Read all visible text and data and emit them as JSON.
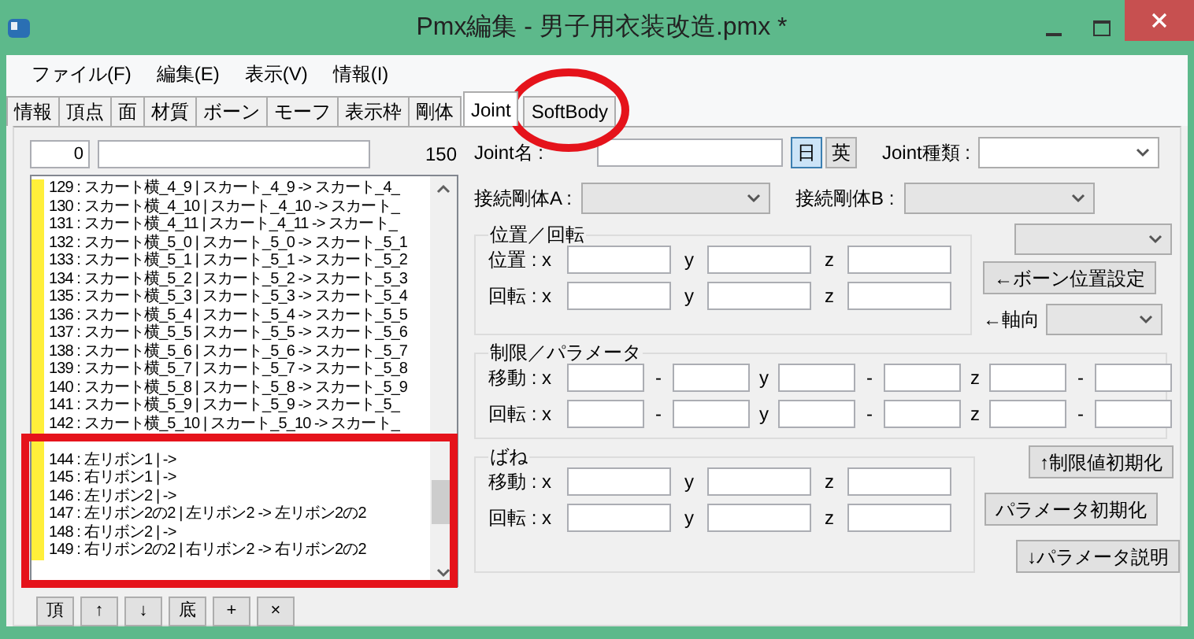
{
  "window": {
    "title": "Pmx編集 - 男子用衣装改造.pmx *"
  },
  "menu": [
    "ファイル(F)",
    "編集(E)",
    "表示(V)",
    "情報(I)"
  ],
  "tabs": [
    {
      "label": "情報",
      "selected": false
    },
    {
      "label": "頂点",
      "selected": false
    },
    {
      "label": "面",
      "selected": false
    },
    {
      "label": "材質",
      "selected": false
    },
    {
      "label": "ボーン",
      "selected": false
    },
    {
      "label": "モーフ",
      "selected": false
    },
    {
      "label": "表示枠",
      "selected": false
    },
    {
      "label": "剛体",
      "selected": false
    },
    {
      "label": "Joint",
      "selected": true
    },
    {
      "label": "SoftBody",
      "selected": false
    }
  ],
  "list_panel": {
    "index_value": "0",
    "count": "150",
    "rows": [
      "129 : スカート横_4_9 | スカート_4_9 -> スカート_4_",
      "130 : スカート横_4_10 | スカート_4_10 -> スカート_",
      "131 : スカート横_4_11 | スカート_4_11 -> スカート_",
      "132 : スカート横_5_0 | スカート_5_0 -> スカート_5_1",
      "133 : スカート横_5_1 | スカート_5_1 -> スカート_5_2",
      "134 : スカート横_5_2 | スカート_5_2 -> スカート_5_3",
      "135 : スカート横_5_3 | スカート_5_3 -> スカート_5_4",
      "136 : スカート横_5_4 | スカート_5_4 -> スカート_5_5",
      "137 : スカート横_5_5 | スカート_5_5 -> スカート_5_6",
      "138 : スカート横_5_6 | スカート_5_6 -> スカート_5_7",
      "139 : スカート横_5_7 | スカート_5_7 -> スカート_5_8",
      "140 : スカート横_5_8 | スカート_5_8 -> スカート_5_9",
      "141 : スカート横_5_9 | スカート_5_9 -> スカート_5_",
      "142 : スカート横_5_10 | スカート_5_10 -> スカート_"
    ],
    "framed_rows": [
      "144 : 左リボン1 | ->",
      "145 : 右リボン1 | ->",
      "146 : 左リボン2 | ->",
      "147 : 左リボン2の2 | 左リボン2 -> 左リボン2の2",
      "148 : 右リボン2 | ->",
      "149 : 右リボン2の2 | 右リボン2 -> 右リボン2の2"
    ],
    "nav_buttons": [
      "頂",
      "↑",
      "↓",
      "底",
      "+",
      "×"
    ]
  },
  "joint": {
    "name_label": "Joint名 :",
    "lang_buttons": [
      {
        "label": "日",
        "selected": true
      },
      {
        "label": "英",
        "selected": false
      }
    ],
    "type_label": "Joint種類 :",
    "body_a_label": "接続剛体A :",
    "body_b_label": "接続剛体B :",
    "groups": [
      {
        "title": "位置／回転",
        "rows": [
          {
            "label": "位置 : x",
            "between": [
              "y",
              "z"
            ]
          },
          {
            "label": "回転 : x",
            "between": [
              "y",
              "z"
            ]
          }
        ]
      },
      {
        "title": "制限／パラメータ",
        "rows": [
          {
            "label": "移動 : x",
            "between": [
              "-",
              "y",
              "-",
              "z",
              "-"
            ]
          },
          {
            "label": "回転 : x",
            "between": [
              "-",
              "y",
              "-",
              "z",
              "-"
            ]
          }
        ]
      },
      {
        "title": "ばね",
        "rows": [
          {
            "label": "移動 : x",
            "between": [
              "y",
              "z"
            ]
          },
          {
            "label": "回転 : x",
            "between": [
              "y",
              "z"
            ]
          }
        ]
      }
    ],
    "bone_position_button": "←ボーン位置設定",
    "axis_label": "←軸向",
    "buttons": [
      "↑制限値初期化",
      "パラメータ初期化",
      "↓パラメータ説明"
    ]
  },
  "annotations": [
    {
      "kind": "circle"
    },
    {
      "kind": "rectangle"
    }
  ]
}
